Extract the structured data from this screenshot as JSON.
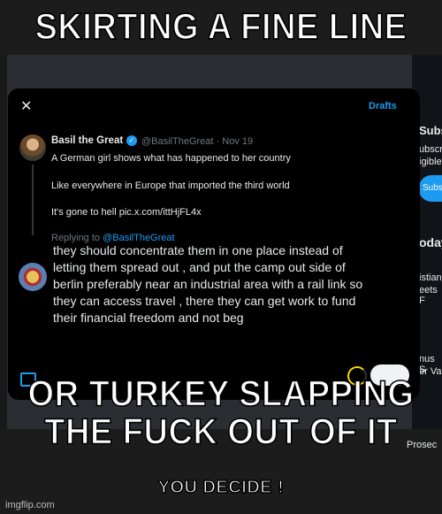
{
  "meme": {
    "top_caption": "SKIRTING A FINE LINE",
    "middle_caption_line1": "OR TURKEY SLAPPING",
    "middle_caption_line2": "THE FUCK OUT OF IT",
    "bottom_caption": "YOU DECIDE !",
    "watermark": "imgflip.com"
  },
  "background": {
    "right_1": "Subs",
    "right_2": "ubscri",
    "right_3": "igible",
    "subscribe_button": "Subs",
    "right_4": "oday",
    "right_5": "istian",
    "right_6": "eets F",
    "right_7": "nus S",
    "right_8": "er Va",
    "right_9": "Prosec"
  },
  "modal": {
    "close_glyph": "✕",
    "drafts_label": "Drafts",
    "original_tweet": {
      "author_name": "Basil the Great",
      "verified_glyph": "✓",
      "handle_date": "@BasilTheGreat · Nov 19",
      "line1": "A German girl shows what has happened to her country",
      "line2": "Like everywhere in Europe that imported the third world",
      "line3": "It's gone to hell pic.x.com/ittHjFL4x"
    },
    "replying_prefix": "Replying to ",
    "replying_handle": "@BasilTheGreat",
    "reply_line1": "they should concentrate them in one place instead of",
    "reply_line2": "letting them spread out , and put the camp out side of",
    "reply_line3": "berlin preferably near an industrial area with a rail link so",
    "reply_line4": "they can access travel , there they can get work to fund",
    "reply_line5": "their financial freedom and not beg"
  },
  "colors": {
    "accent": "#1d9bf0",
    "modal_bg": "#000000",
    "text": "#e7e9ea",
    "muted": "#71767b"
  }
}
